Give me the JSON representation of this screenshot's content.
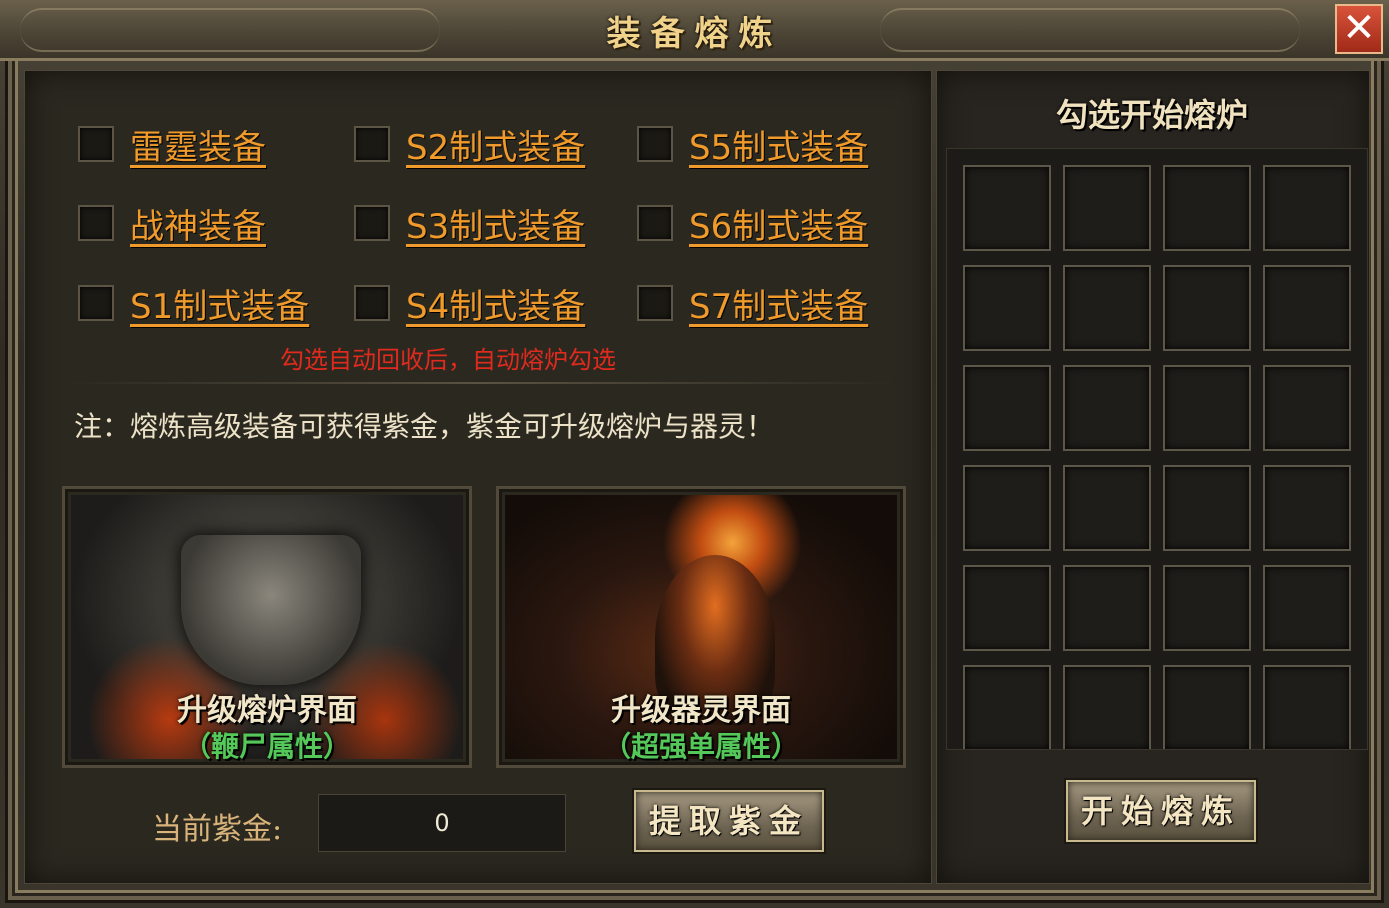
{
  "window": {
    "title": "装备熔炼",
    "close_label": "✕"
  },
  "options": [
    {
      "label": "雷霆装备"
    },
    {
      "label": "S2制式装备"
    },
    {
      "label": "S5制式装备"
    },
    {
      "label": "战神装备"
    },
    {
      "label": "S3制式装备"
    },
    {
      "label": "S6制式装备"
    },
    {
      "label": "S1制式装备"
    },
    {
      "label": "S4制式装备"
    },
    {
      "label": "S7制式装备"
    }
  ],
  "hint": "勾选自动回收后，自动熔炉勾选",
  "note": "注：熔炼高级装备可获得紫金，紫金可升级熔炉与器灵！",
  "cards": [
    {
      "title": "升级熔炉界面",
      "subtitle": "（鞭尸属性）"
    },
    {
      "title": "升级器灵界面",
      "subtitle": "（超强单属性）"
    }
  ],
  "zijin": {
    "label": "当前紫金:",
    "value": "0",
    "extract_button": "提取紫金"
  },
  "furnace": {
    "title": "勾选开始熔炉",
    "start_button": "开始熔炼"
  },
  "colors": {
    "accent_orange": "#ef9a2a",
    "hint_red": "#e02a1e",
    "sub_green": "#54c95a",
    "close_red": "#c23b22"
  }
}
